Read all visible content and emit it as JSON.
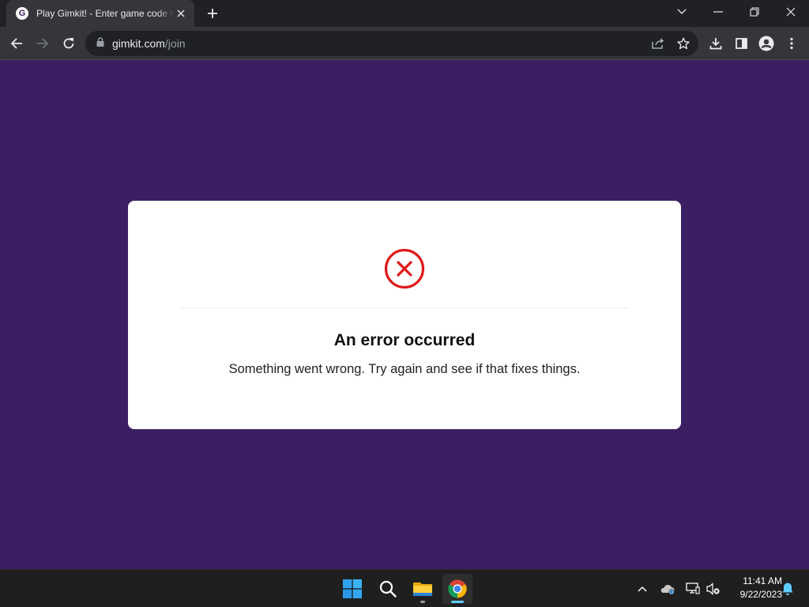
{
  "browser": {
    "tab": {
      "favicon_letter": "G",
      "title": "Play Gimkit! - Enter game code here"
    },
    "address": {
      "host": "gimkit.com",
      "path": "/join"
    }
  },
  "page": {
    "error_card": {
      "title": "An error occurred",
      "message": "Something went wrong. Try again and see if that fixes things."
    },
    "colors": {
      "background": "#3b1f63",
      "error_red": "#e01919"
    }
  },
  "taskbar": {
    "apps": [
      "start-icon",
      "search-icon",
      "file-explorer-icon",
      "chrome-icon"
    ],
    "clock": {
      "time": "11:41 AM",
      "date": "9/22/2023"
    }
  }
}
